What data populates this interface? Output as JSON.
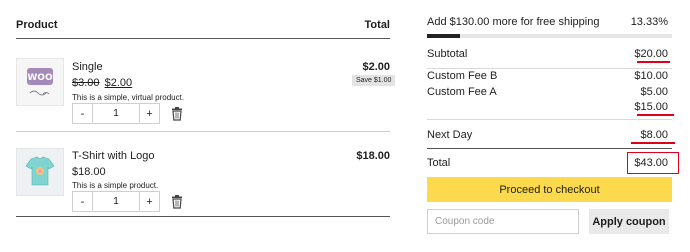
{
  "cart": {
    "header": {
      "product": "Product",
      "total": "Total"
    },
    "items": [
      {
        "name": "Single",
        "regular_price": "$3.00",
        "sale_price": "$2.00",
        "description": "This is a simple, virtual product.",
        "quantity": "1",
        "line_total": "$2.00",
        "save_badge": "Save $1.00",
        "image_icon": "woo-album-thumbnail",
        "image_text": "WOO"
      },
      {
        "name": "T-Shirt with Logo",
        "price": "$18.00",
        "description": "This is a simple product.",
        "quantity": "1",
        "line_total": "$18.00",
        "image_icon": "tshirt-thumbnail"
      }
    ],
    "qty_minus": "-",
    "qty_plus": "+"
  },
  "shipping": {
    "message": "Add $130.00 more for free shipping",
    "percent_label": "13.33%",
    "progress": 0.1333
  },
  "totals": {
    "subtotal_label": "Subtotal",
    "subtotal_value": "$20.00",
    "fees": [
      {
        "label": "Custom Fee B",
        "value": "$10.00"
      },
      {
        "label": "Custom Fee A",
        "value": "$5.00"
      }
    ],
    "fees_total": "$15.00",
    "shipping_label": "Next Day",
    "shipping_value": "$8.00",
    "total_label": "Total",
    "total_value": "$43.00"
  },
  "actions": {
    "checkout_label": "Proceed to checkout",
    "coupon_placeholder": "Coupon code",
    "apply_label": "Apply coupon"
  },
  "colors": {
    "checkout_bg": "#fcd94d",
    "annotation_red": "#e0001b",
    "progress_fill": "#222222"
  }
}
